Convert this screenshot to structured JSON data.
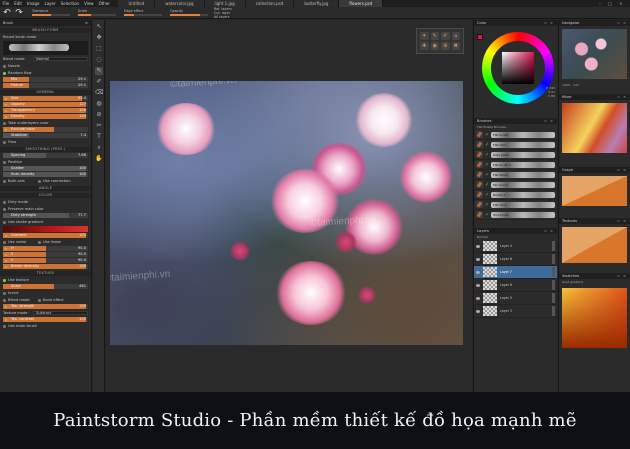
{
  "menubar": {
    "items": [
      "File",
      "Edit",
      "Image",
      "Layer",
      "Selection",
      "View",
      "Other"
    ],
    "tabs": [
      "Untitled",
      "watercolor.jpg",
      "light 1.jpg",
      "collection.psd",
      "butterfly.jpg",
      "flowers.psd"
    ],
    "active_tab_index": 5,
    "window_controls": "– □ ×"
  },
  "toolbar": {
    "undo": "↶",
    "redo": "↷",
    "sliders": [
      {
        "label": "Tolerance",
        "fill": 0.5
      },
      {
        "label": "Scale",
        "fill": 0.35
      },
      {
        "label": "Edge effect",
        "fill": 0.25
      },
      {
        "label": "Opacity",
        "fill": 0.8
      }
    ],
    "options": [
      "Ref. layers",
      "Cur. layer",
      "All layers"
    ]
  },
  "left_panel": {
    "title": "Brush",
    "sections": {
      "brush_form": "BRUSH FORM",
      "general": "GENERAL",
      "smoothing": "SMOOTHING (PRES.)",
      "angle": "ANGLE",
      "color": "COLOR",
      "texture": "TEXTURE"
    },
    "brush_file": "Round brush mask",
    "blend_mode_label": "Blend mode",
    "blend_mode_value": "Normal",
    "toggles_top": [
      "Nozzle",
      "Random flow"
    ],
    "sliders_top": [
      {
        "label": "Mix",
        "value": "29.1",
        "fill": 0.3
      },
      {
        "label": "Fixture",
        "value": "29.1",
        "fill": 0.3
      }
    ],
    "general_sliders": [
      {
        "label": "Size",
        "value": "93.4",
        "fill": 0.93
      },
      {
        "label": "Opacity",
        "value": "127",
        "fill": 0.98
      },
      {
        "label": "Transparency",
        "value": "100",
        "fill": 0.98
      },
      {
        "label": "Density",
        "value": "100",
        "fill": 0.98
      }
    ],
    "general_opts": [
      "Take underlayers color",
      "Exclude color"
    ],
    "general_sliders2": [
      {
        "label": "Stabilizer",
        "value": "7.4",
        "fill": 0.3
      }
    ],
    "general_opts2": [
      "Flow"
    ],
    "smoothing_sliders": [
      {
        "label": "Spacing",
        "value": "7.66",
        "fill": 0.5
      },
      {
        "label": "Scatter",
        "value": "100",
        "fill": 0.98
      },
      {
        "label": "Scat. density",
        "value": "100",
        "fill": 0.98
      }
    ],
    "smoothing_opts": [
      "Position",
      "Both axis",
      "Use connection"
    ],
    "color_opts": [
      "Dirty mode",
      "Preserve main color",
      "Use stroke gradient"
    ],
    "dirty_strength": {
      "label": "Dirty strength",
      "value": "77.7"
    },
    "gradient": {
      "label": "Gradient",
      "value": "100"
    },
    "color_opts2": [
      "Use radial",
      "Use linear"
    ],
    "color_sliders": [
      {
        "label": "H",
        "value": "90.0",
        "fill": 0.5
      },
      {
        "label": "S",
        "value": "90.0",
        "fill": 0.5
      },
      {
        "label": "V",
        "value": "90.0",
        "fill": 0.5
      },
      {
        "label": "Bristle diversity",
        "value": "100",
        "fill": 0.98
      }
    ],
    "texture_opts": [
      "Use texture"
    ],
    "scale": {
      "label": "Scale",
      "value": "461"
    },
    "texture_opts2": [
      "Invert",
      "Blend mode",
      "Band effect"
    ],
    "tex_strength": {
      "label": "Tex. strength",
      "value": "100"
    },
    "texture_mode_label": "Texture mode",
    "texture_mode_value": "Subtract",
    "tex_contrast": {
      "label": "Tex. contrast",
      "value": "100"
    },
    "mask_opt": "Use mask brush"
  },
  "tools": [
    "↖",
    "✥",
    "⬚",
    "◌",
    "✎",
    "✐",
    "⌫",
    "◍",
    "⊘",
    "✂",
    "T",
    "⌕",
    "✋"
  ],
  "quick_tools": [
    "✦",
    "✎",
    "✐",
    "⌂",
    "✚",
    "◉",
    "⊕",
    "✖"
  ],
  "right1": {
    "color_title": "Color",
    "color_values": [
      "H 345",
      "S 91",
      "V 88"
    ],
    "brushes_title": "Brushes",
    "brushes_subtitle": "Flat Bristle Brushes",
    "brushes": [
      "Flat brush",
      "Flat dots",
      "Dots paint",
      "Flat brush 2",
      "Flat finish",
      "Fan brush",
      "Bristle 2",
      "Flat dirty",
      "Fine brush"
    ],
    "layers_title": "Layers",
    "layers_mode": "Normal",
    "layers": [
      "Layer 4",
      "Layer 8",
      "Layer 7",
      "Layer 6",
      "Layer 5",
      "Layer 3"
    ],
    "selected_layer_index": 2
  },
  "right2": {
    "navigator_title": "Navigator",
    "nav_values": [
      "100%",
      "0.0°"
    ],
    "mixer_title": "Mixer",
    "graph_title": "Graph",
    "textures_title": "Textures",
    "swatches_title": "Swatches",
    "swatches_sub": "Grad gradient"
  },
  "caption": "Paintstorm Studio - Phần mềm thiết kế đồ họa mạnh mẽ",
  "watermark": "©taimienphi.vn",
  "colors": {
    "accent": "#cf7235",
    "selected_color": "#e0134b",
    "layer_sel": "#3f6d9a"
  }
}
